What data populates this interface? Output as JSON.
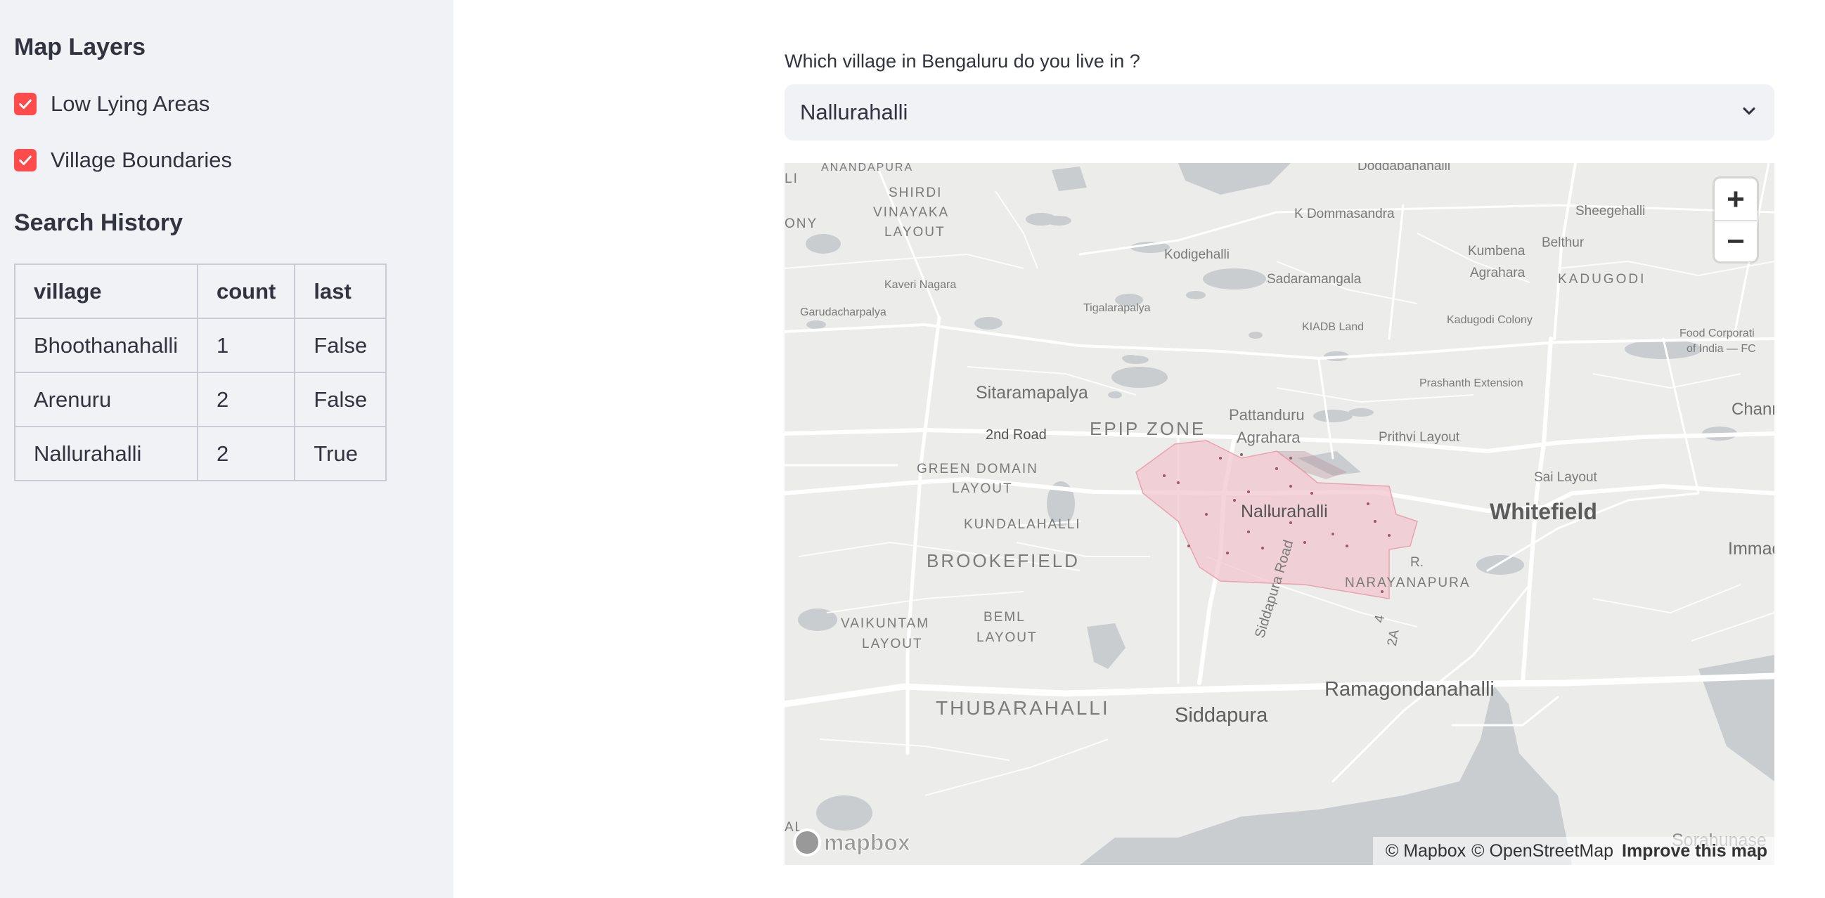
{
  "sidebar": {
    "map_layers_heading": "Map Layers",
    "layers": [
      {
        "label": "Low Lying Areas",
        "checked": true
      },
      {
        "label": "Village Boundaries",
        "checked": true
      }
    ],
    "search_history_heading": "Search History",
    "table": {
      "headers": [
        "village",
        "count",
        "last"
      ],
      "rows": [
        [
          "Bhoothanahalli",
          "1",
          "False"
        ],
        [
          "Arenuru",
          "2",
          "False"
        ],
        [
          "Nallurahalli",
          "2",
          "True"
        ]
      ]
    }
  },
  "main": {
    "select_label": "Which village in Bengaluru do you live in ?",
    "select_value": "Nallurahalli"
  },
  "map": {
    "labels": {
      "doddabanahalli": "Doddabanahalli",
      "anandapura": "ANANDAPURA",
      "shirdi": "SHIRDI",
      "vinayaka": "VINAYAKA",
      "layout1": "LAYOUT",
      "k_dommasandra": "K Dommasandra",
      "sheegehalli": "Sheegehalli",
      "kodigehalli": "Kodigehalli",
      "kumbena": "Kumbena",
      "agrahara1": "Agrahara",
      "belthur": "Belthur",
      "sadaramangala": "Sadaramangala",
      "kadugodi": "KADUGODI",
      "kaveri_nagara": "Kaveri Nagara",
      "garudacharpalya": "Garudacharpalya",
      "tigalarapalya": "Tigalarapalya",
      "kiadb_land": "KIADB Land",
      "kadugodi_colony": "Kadugodi Colony",
      "food_corp": "Food Corporati",
      "of_india": "of India — FC",
      "prashanth_ext": "Prashanth Extension",
      "sitaramapalya": "Sitaramapalya",
      "pattanduru": "Pattanduru",
      "agrahara2": "Agrahara",
      "chann": "Chann",
      "second_road": "2nd Road",
      "epip_zone": "EPIP ZONE",
      "prithvi_layout": "Prithvi Layout",
      "green_domain": "GREEN DOMAIN",
      "layout2": "LAYOUT",
      "sai_layout": "Sai Layout",
      "nallurahalli": "Nallurahalli",
      "whitefield": "Whitefield",
      "kundalahalli": "KUNDALAHALLI",
      "immad": "Immad",
      "brookefield": "BROOKEFIELD",
      "r": "R.",
      "narayanapura": "NARAYANAPURA",
      "siddapura_road": "Siddapura Road",
      "vaikuntam": "VAIKUNTAM",
      "layout3": "LAYOUT",
      "beml": "BEML",
      "layout4": "LAYOUT",
      "four": "4",
      "twoa": "2A",
      "thubarahalli": "THUBARAHALLI",
      "ramagondanahalli": "Ramagondanahalli",
      "siddapura": "Siddapura",
      "sorahunase": "Sorahunase",
      "li": "LI",
      "ony": "ONY",
      "al": "AL"
    },
    "zoom_in": "+",
    "zoom_out": "−",
    "attribution_mapbox": "© Mapbox",
    "attribution_osm": "© OpenStreetMap",
    "improve_map": "Improve this map",
    "logo_text": "mapbox"
  },
  "colors": {
    "accent": "#ff4b4b",
    "sidebar_bg": "#f0f2f6",
    "village_fill": "#f2c6cf"
  }
}
